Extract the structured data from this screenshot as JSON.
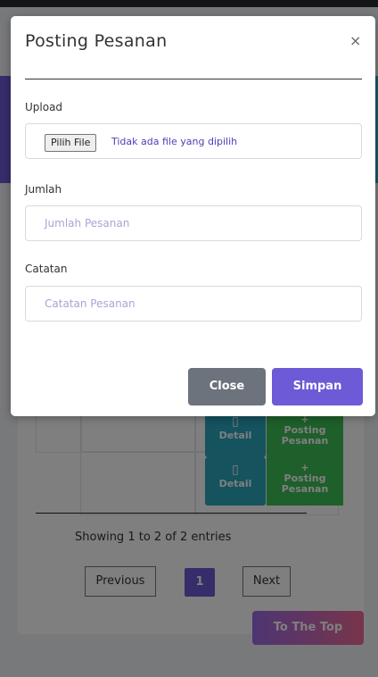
{
  "modal": {
    "title": "Posting Pesanan",
    "close_icon": "×",
    "upload_label": "Upload",
    "file_button": "Pilih File",
    "file_status": "Tidak ada file yang dipilih",
    "jumlah_label": "Jumlah",
    "jumlah_placeholder": "Jumlah Pesanan",
    "catatan_label": "Catatan",
    "catatan_placeholder": "Catatan Pesanan",
    "close_button": "Close",
    "save_button": "Simpan"
  },
  "table": {
    "rows": [
      {
        "detail": "Detail",
        "post_plus": "+",
        "post_line1": "Posting",
        "post_line2": "Pesanan"
      },
      {
        "detail": "Detail",
        "post_plus": "+",
        "post_line1": "Posting",
        "post_line2": "Pesanan"
      }
    ],
    "detail_icon": "document-icon"
  },
  "pagination": {
    "info": "Showing 1 to 2 of 2 entries",
    "previous": "Previous",
    "current": "1",
    "next": "Next"
  },
  "to_top": "To The Top",
  "colors": {
    "accent": "#6c5ad6",
    "detail": "#2aa7bf",
    "posting": "#3cbf57",
    "close": "#6c737d"
  }
}
